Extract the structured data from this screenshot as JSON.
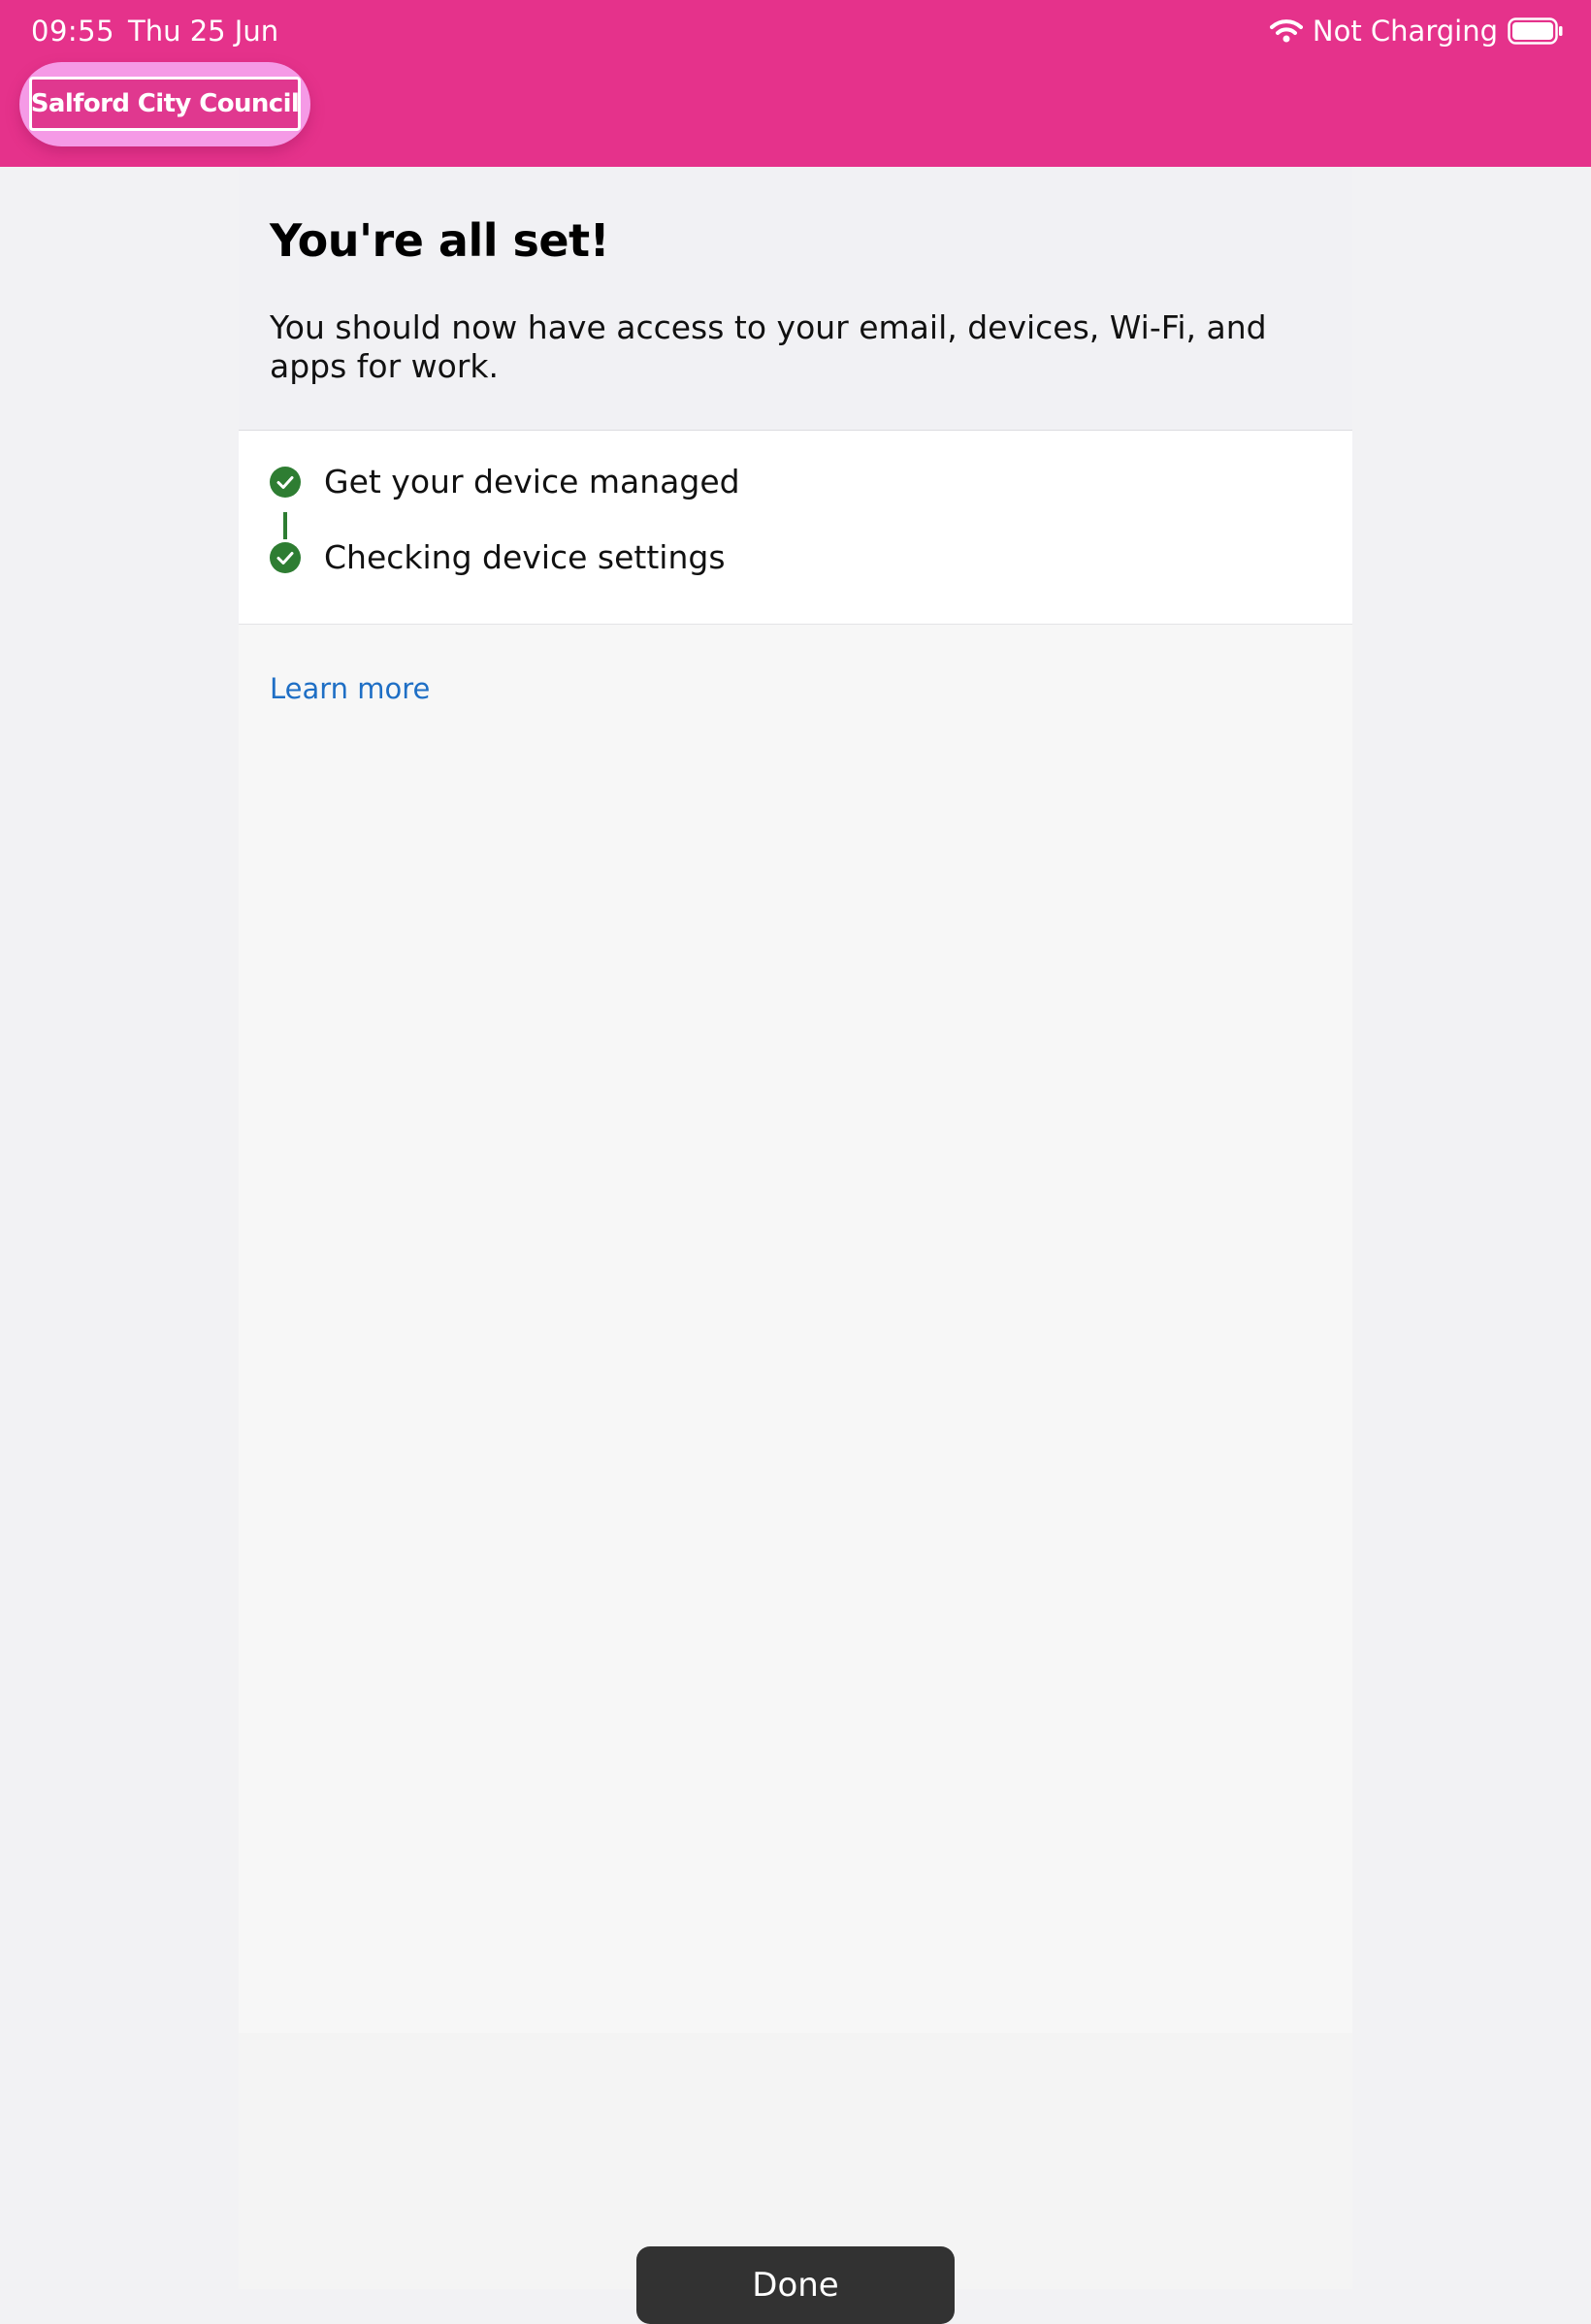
{
  "status_bar": {
    "time": "09:55",
    "date": "Thu 25 Jun",
    "charging_status": "Not Charging",
    "wifi_icon": "wifi-icon",
    "battery_icon": "battery-icon"
  },
  "header": {
    "background_color": "#e5328b",
    "organization_name": "Salford City Council"
  },
  "intro": {
    "title": "You're all set!",
    "description": "You should now have access to your email, devices, Wi-Fi, and apps for work."
  },
  "steps": [
    {
      "label": "Get your device managed",
      "status": "complete",
      "icon": "check-circle-icon"
    },
    {
      "label": "Checking device settings",
      "status": "complete",
      "icon": "check-circle-icon"
    }
  ],
  "status_color": "#2e7d32",
  "link_color": "#1f6fc5",
  "learn_more_label": "Learn more",
  "done_button_label": "Done"
}
